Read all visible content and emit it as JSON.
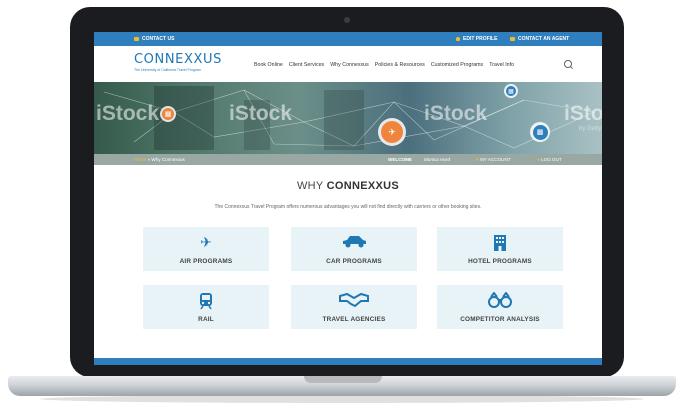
{
  "topbar": {
    "contact": "CONTACT US",
    "edit_profile": "EDIT PROFILE",
    "contact_agent": "CONTACT AN AGENT"
  },
  "header": {
    "logo_name": "CONNEXXUS",
    "logo_tagline": "The University of California Travel Program",
    "nav": [
      "Book Online",
      "Client Services",
      "Why Connexxus",
      "Policies & Resources",
      "Customized Programs",
      "Travel Info"
    ]
  },
  "hero": {
    "watermarks": [
      "iStock",
      "iStock",
      "iStock",
      "iStock"
    ],
    "watermark_sub": "by Getty"
  },
  "breadcrumb": {
    "home": "Home",
    "current": "Why Connexxus"
  },
  "welcome": {
    "label": "WELCOME",
    "user": "Monica Hurd",
    "my_account": "MY ACCOUNT",
    "log_out": "LOG OUT"
  },
  "page": {
    "title_prefix": "WHY",
    "title_bold": "CONNEXXUS",
    "intro": "The Connexxus Travel Program offers numerous advantages you will not find directly with carriers or other booking sites."
  },
  "tiles": [
    {
      "label": "AIR PROGRAMS",
      "icon": "airplane-icon"
    },
    {
      "label": "CAR PROGRAMS",
      "icon": "car-icon"
    },
    {
      "label": "HOTEL PROGRAMS",
      "icon": "hotel-icon"
    },
    {
      "label": "RAIL",
      "icon": "train-icon"
    },
    {
      "label": "TRAVEL AGENCIES",
      "icon": "handshake-icon"
    },
    {
      "label": "COMPETITOR ANALYSIS",
      "icon": "binoculars-icon"
    }
  ],
  "colors": {
    "brand_blue": "#2f7ebd",
    "accent_orange": "#f0843c",
    "accent_yellow": "#f5b82a",
    "tile_bg": "#e7f3f7"
  }
}
